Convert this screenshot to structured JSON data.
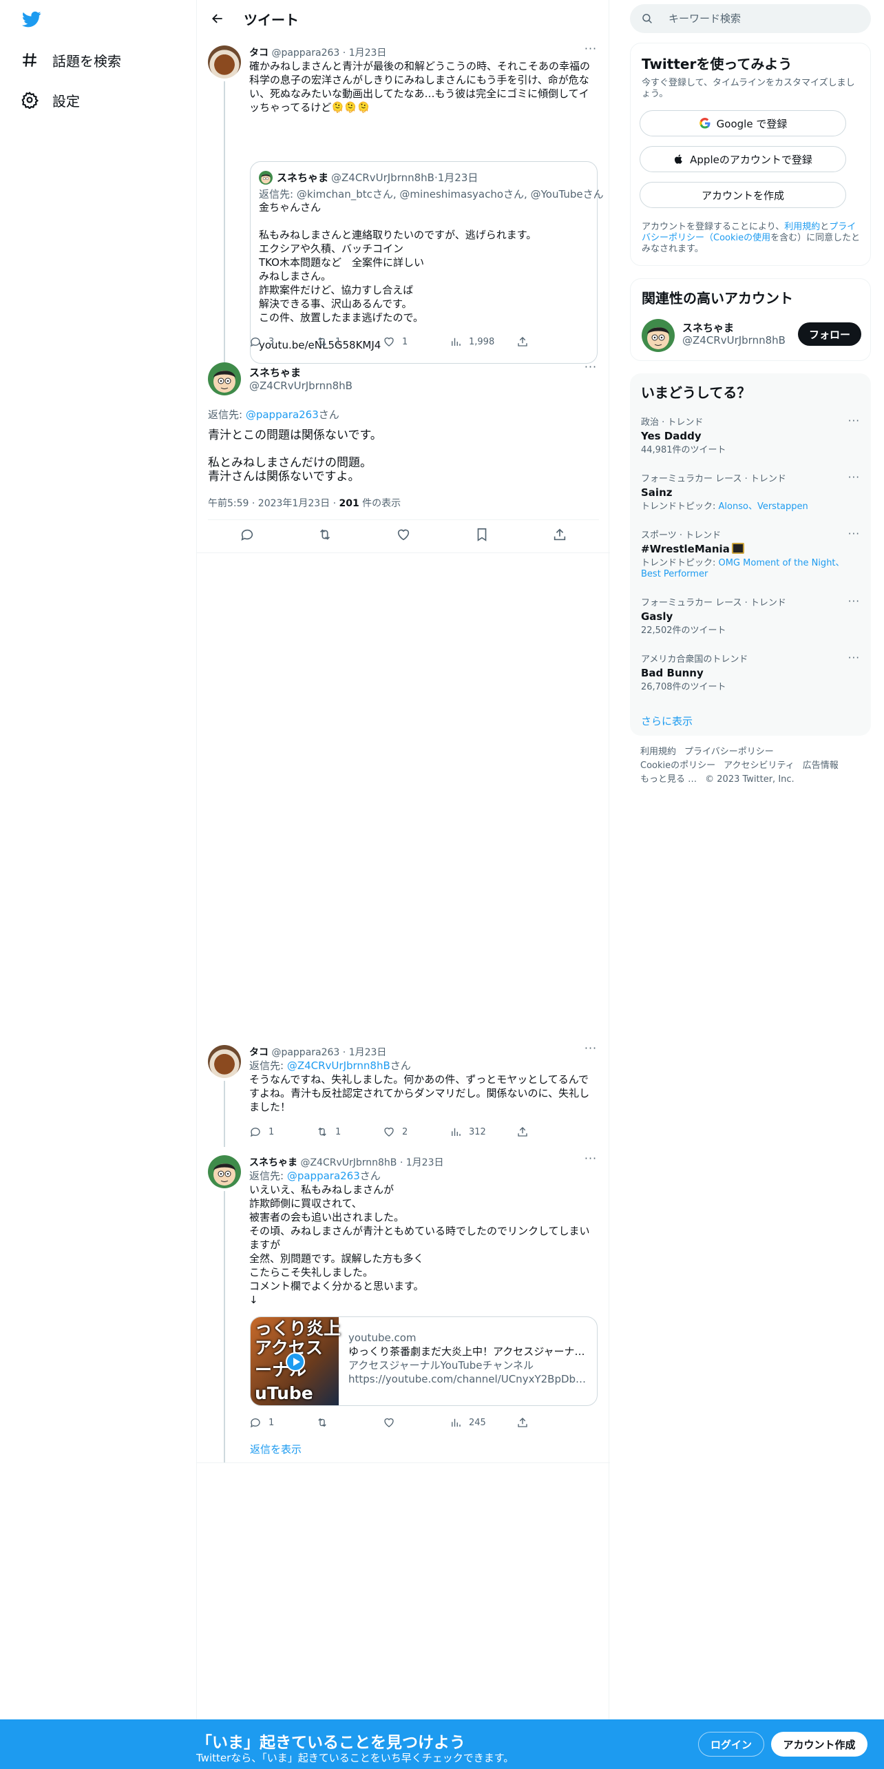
{
  "nav": {
    "explore_label": "話題を検索",
    "settings_label": "設定"
  },
  "header": {
    "title": "ツイート"
  },
  "tweets": {
    "parent": {
      "name": "タコ",
      "handle": "@pappara263",
      "date": "1月23日",
      "text": "確かみねしまさんと青汁が最後の和解どうこうの時、それこそあの幸福の科学の息子の宏洋さんがしきりにみねしまさんにもう手を引け、命が危ない、死ぬなみたいな動画出してたなあ…もう彼は完全にゴミに傾倒してイッちゃってるけど🫠🫠🫠",
      "quote": {
        "name": "スネちゃま",
        "handle": "@Z4CRvUrJbrnn8hB",
        "date": "1月23日",
        "reply_to_prefix": "返信先: ",
        "reply_to": "@kimchan_btcさん, @mineshimasyachoさん, @YouTubeさん",
        "text": "金ちゃんさん\n\n私もみねしまさんと連絡取りたいのですが、逃げられます。\nエクシアや久積、バッチコイン\nTKO木本問題など　全案件に詳しい\nみねしまさん。\n詐欺案件だけど、協力すし合えば\n解決できる事、沢山あるんです。\nこの件、放置したまま逃げたので。\n\nyoutu.be/eNL5G58KMJ4"
      },
      "replies": "3",
      "retweets": "1",
      "likes": "1",
      "views": "1,998"
    },
    "focus": {
      "name": "スネちゃま",
      "handle": "@Z4CRvUrJbrnn8hB",
      "reply_prefix": "返信先: ",
      "reply_handle": "@pappara263",
      "reply_suffix": "さん",
      "text": "青汁とこの問題は関係ないです。\n\n私とみねしまさんだけの問題。\n青汁さんは関係ないですよ。",
      "time": "午前5:59 · 2023年1月23日 · ",
      "views": "201",
      "views_suffix": " 件の表示"
    },
    "reply1": {
      "name": "タコ",
      "handle": "@pappara263",
      "date": "1月23日",
      "reply_prefix": "返信先: ",
      "reply_handle": "@Z4CRvUrJbrnn8hB",
      "reply_suffix": "さん",
      "text": "そうなんですね、失礼しました。何かあの件、ずっとモヤッとしてるんですよね。青汁も反社認定されてからダンマリだし。関係ないのに、失礼しました！",
      "replies": "1",
      "retweets": "1",
      "likes": "2",
      "views": "312"
    },
    "reply2": {
      "name": "スネちゃま",
      "handle": "@Z4CRvUrJbrnn8hB",
      "date": "1月23日",
      "reply_prefix": "返信先: ",
      "reply_handle": "@pappara263",
      "reply_suffix": "さん",
      "text": "いえいえ、私もみねしまさんが\n詐欺師側に買収されて、\n被害者の会も追い出されました。\nその頃、みねしまさんが青汁ともめている時でしたのでリンクしてしまいますが\n全然、別問題です。誤解した方も多く\nこたらこそ失礼しました。\nコメント欄でよく分かると思います。\n↓",
      "card": {
        "thumb_lines": [
          "っくり炎上",
          "アクセス",
          "ーナル",
          "uTube"
        ],
        "domain": "youtube.com",
        "title": "ゆっくり茶番劇まだ大炎上中！アクセスジャーナル…",
        "desc": "アクセスジャーナルYouTubeチャンネル",
        "url": "https://youtube.com/channel/UCnyxY2BpDbbFpx3J…"
      },
      "replies": "1",
      "views": "245"
    },
    "show_replies": "返信を表示"
  },
  "sidebar": {
    "search_placeholder": "キーワード検索",
    "signup": {
      "title": "Twitterを使ってみよう",
      "subtitle": "今すぐ登録して、タイムラインをカスタマイズしましょう。",
      "google": "Google で登録",
      "apple": "Appleのアカウントで登録",
      "create": "アカウントを作成",
      "terms_1": "アカウントを登録することにより、",
      "terms_link1": "利用規約",
      "terms_2": "と",
      "terms_link2": "プライバシーポリシー（Cookieの使用",
      "terms_3": "を含む）に同意したとみなされます。"
    },
    "related": {
      "title": "関連性の高いアカウント",
      "name": "スネちゃま",
      "handle": "@Z4CRvUrJbrnn8hB",
      "follow": "フォロー"
    },
    "trends": {
      "title": "いまどうしてる？",
      "items": [
        {
          "category": "政治 · トレンド",
          "name": "Yes Daddy",
          "sub": "44,981件のツイート"
        },
        {
          "category": "フォーミュラカー レース · トレンド",
          "name": "Sainz",
          "sub_prefix": "トレンドトピック: ",
          "sub_links": "Alonso、Verstappen"
        },
        {
          "category": "スポーツ · トレンド",
          "name": "#WrestleMania",
          "sub_prefix": "トレンドトピック: ",
          "sub_links": "OMG Moment of the Night、Best Performer"
        },
        {
          "category": "フォーミュラカー レース · トレンド",
          "name": "Gasly",
          "sub": "22,502件のツイート"
        },
        {
          "category": "アメリカ合衆国のトレンド",
          "name": "Bad Bunny",
          "sub": "26,708件のツイート"
        }
      ],
      "show_more": "さらに表示"
    },
    "footer": {
      "links": [
        "利用規約",
        "プライバシーポリシー",
        "Cookieのポリシー",
        "アクセシビリティ",
        "広告情報",
        "もっと見る …"
      ],
      "copyright": "© 2023 Twitter, Inc."
    }
  },
  "bottom_bar": {
    "title": "「いま」起きていることを見つけよう",
    "subtitle": "Twitterなら、「いま」起きていることをいち早くチェックできます。",
    "login": "ログイン",
    "signup": "アカウント作成"
  },
  "colors": {
    "accent": "#1d9bf0",
    "text": "#0f1419",
    "muted": "#536471"
  }
}
